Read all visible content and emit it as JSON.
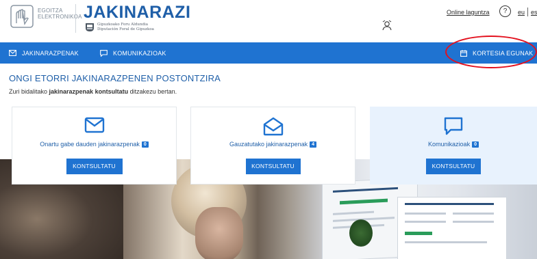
{
  "header": {
    "org_line1": "EGOITZA",
    "org_line2": "ELEKTRONIKOA",
    "app_title": "JAKINARAZI",
    "gipuzkoa_line1": "Gipuzkoako Foru Aldundia",
    "gipuzkoa_line2": "Diputación Foral de Gipuzkoa",
    "online_help": "Online laguntza",
    "help_icon_glyph": "?",
    "lang_eu": "eu",
    "lang_es": "es"
  },
  "nav": {
    "items": [
      {
        "label": "JAKINARAZPENAK",
        "icon": "envelope-icon"
      },
      {
        "label": "KOMUNIKAZIOAK",
        "icon": "speech-bubble-icon"
      }
    ],
    "right_item": {
      "label": "KORTESIA EGUNAK",
      "icon": "calendar-icon"
    }
  },
  "welcome": {
    "title": "ONGI ETORRI JAKINARAZPENEN POSTONTZIRA",
    "sub_before": "Zuri bidalitako ",
    "sub_bold": "jakinarazpenak kontsultatu",
    "sub_after": " ditzakezu bertan."
  },
  "cards": [
    {
      "label": "Onartu gabe dauden jakinarazpenak",
      "count": "0",
      "button": "KONTSULTATU",
      "icon": "envelope-icon"
    },
    {
      "label": "Gauzatutako jakinarazpenak",
      "count": "4",
      "button": "KONTSULTATU",
      "icon": "open-envelope-icon"
    },
    {
      "label": "Komunikazioak",
      "count": "0",
      "button": "KONTSULTATU",
      "icon": "speech-bubble-icon"
    }
  ],
  "colors": {
    "brand_blue": "#1f73d1",
    "title_blue": "#1f5fa8",
    "highlight_red": "#e3101d"
  }
}
